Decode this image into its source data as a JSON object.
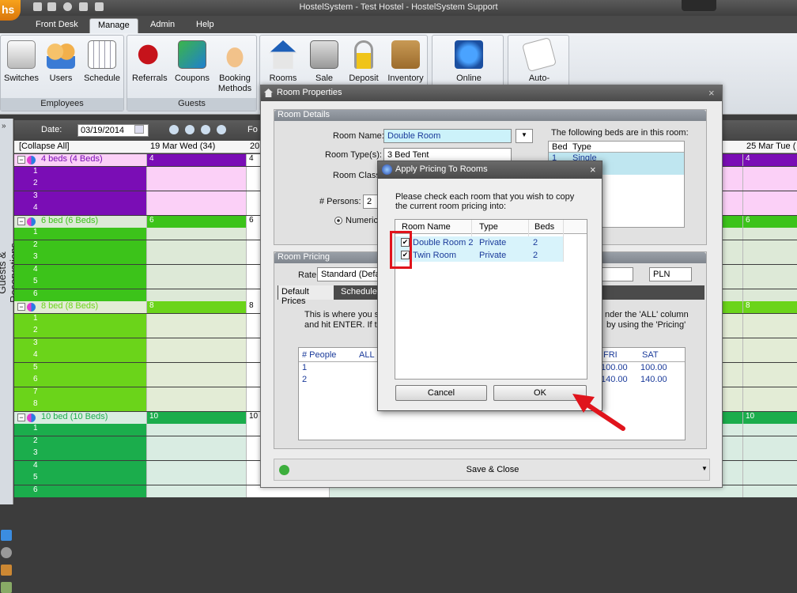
{
  "app": {
    "logo_text": "hs",
    "title": "HostelSystem - Test Hostel - HostelSystem Support"
  },
  "menu": {
    "tabs": [
      "Front Desk",
      "Manage",
      "Admin",
      "Help"
    ],
    "active": "Manage"
  },
  "ribbon": {
    "groups": [
      {
        "label": "Employees",
        "buttons": [
          {
            "label": "Switches",
            "icon": "switch-icon"
          },
          {
            "label": "Users",
            "icon": "users-icon"
          },
          {
            "label": "Schedule",
            "icon": "calendar-icon"
          }
        ]
      },
      {
        "label": "Guests",
        "buttons": [
          {
            "label": "Referrals",
            "icon": "phone-icon"
          },
          {
            "label": "Coupons",
            "icon": "coupon-icon"
          },
          {
            "label": "Booking Methods",
            "icon": "thumbs-up-icon"
          }
        ]
      },
      {
        "label": "",
        "buttons": [
          {
            "label": "Rooms",
            "icon": "house-icon"
          },
          {
            "label": "Sale",
            "icon": "cash-register-icon"
          },
          {
            "label": "Deposit",
            "icon": "lock-icon"
          },
          {
            "label": "Inventory",
            "icon": "box-icon"
          }
        ]
      },
      {
        "label": "",
        "buttons": [
          {
            "label": "Online",
            "icon": "globe-icon"
          }
        ]
      },
      {
        "label": "",
        "buttons": [
          {
            "label": "Auto-",
            "icon": "envelope-icon"
          }
        ]
      }
    ]
  },
  "sidebar": {
    "label": "Guests & Reservations"
  },
  "grid": {
    "date_label": "Date:",
    "date_value": "03/19/2014",
    "fo_label": "Fo",
    "collapse": "[Collapse All]",
    "columns": [
      "19 Mar Wed (34)",
      "20",
      "25 Mar Tue ("
    ],
    "groups": [
      {
        "name": "4 beds (4 Beds)",
        "count": "4",
        "beds": [
          "1",
          "2",
          "3",
          "4"
        ],
        "color": "#7a0db5",
        "light": "#fbd0f7"
      },
      {
        "name": "6 bed (6 Beds)",
        "count": "6",
        "beds": [
          "1",
          "2",
          "3",
          "4",
          "5",
          "6"
        ],
        "color": "#3cc31a",
        "light": "#dde9d7"
      },
      {
        "name": "8 bed (8 Beds)",
        "count": "8",
        "beds": [
          "1",
          "2",
          "3",
          "4",
          "5",
          "6",
          "7",
          "8"
        ],
        "color": "#6bd41a",
        "light": "#e3ecd6"
      },
      {
        "name": "10 bed (10 Beds)",
        "count": "10",
        "beds": [
          "1",
          "2",
          "3",
          "4",
          "5",
          "6"
        ],
        "color": "#1bad4c",
        "light": "#d9ece2"
      }
    ]
  },
  "room_props": {
    "title": "Room Properties",
    "details_header": "Room Details",
    "room_name_label": "Room Name:",
    "room_name": "Double Room",
    "room_types_label": "Room Type(s):",
    "room_type": "3 Bed Tent",
    "room_class_label": "Room Class:",
    "persons_label": "# Persons:",
    "persons": "2",
    "numeric_label": "Numeric",
    "beds_text": "The following beds are in this room:",
    "beds_cols": [
      "Bed",
      "Type"
    ],
    "beds_rows": [
      {
        "bed": "1",
        "type": "Single"
      }
    ],
    "pricing_header": "Room Pricing",
    "rate_label": "Rate:",
    "rate_value": "Standard (Defau",
    "currency": "PLN",
    "tabs": [
      "Default Prices",
      "Schedule"
    ],
    "desc1": "This is where you se",
    "desc1b": "nder the 'ALL' column",
    "desc2": "and hit ENTER.  If th",
    "desc2b": "by using the 'Pricing'",
    "price_cols": [
      "# People",
      "ALL",
      "FRI",
      "SAT"
    ],
    "price_rows": [
      {
        "people": "1",
        "fri": "100.00",
        "sat": "100.00"
      },
      {
        "people": "2",
        "fri": "140.00",
        "sat": "140.00"
      }
    ],
    "save_close": "Save & Close"
  },
  "apply": {
    "title": "Apply Pricing To Rooms",
    "instructions": "Please check each room that you wish to copy the current room pricing into:",
    "cols": [
      "Room Name",
      "Type",
      "Beds"
    ],
    "rows": [
      {
        "name": "Double Room 2",
        "type": "Private",
        "beds": "2"
      },
      {
        "name": "Twin Room",
        "type": "Private",
        "beds": "2"
      }
    ],
    "cancel": "Cancel",
    "ok": "OK"
  },
  "colors": {
    "highlight": "#e0141c",
    "arrow": "#e0141c"
  }
}
